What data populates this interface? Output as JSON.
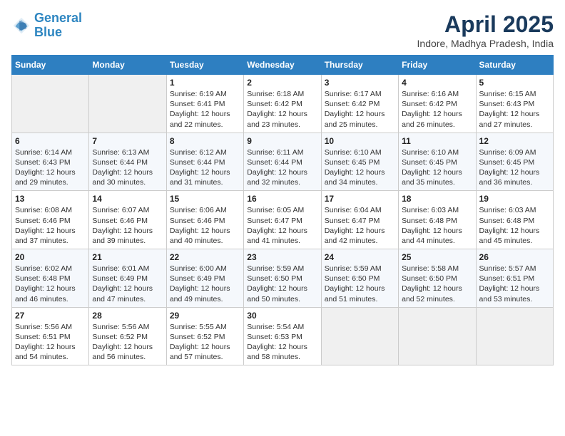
{
  "header": {
    "logo_line1": "General",
    "logo_line2": "Blue",
    "title": "April 2025",
    "subtitle": "Indore, Madhya Pradesh, India"
  },
  "days_of_week": [
    "Sunday",
    "Monday",
    "Tuesday",
    "Wednesday",
    "Thursday",
    "Friday",
    "Saturday"
  ],
  "weeks": [
    [
      {
        "day": "",
        "sunrise": "",
        "sunset": "",
        "daylight": ""
      },
      {
        "day": "",
        "sunrise": "",
        "sunset": "",
        "daylight": ""
      },
      {
        "day": "1",
        "sunrise": "Sunrise: 6:19 AM",
        "sunset": "Sunset: 6:41 PM",
        "daylight": "Daylight: 12 hours and 22 minutes."
      },
      {
        "day": "2",
        "sunrise": "Sunrise: 6:18 AM",
        "sunset": "Sunset: 6:42 PM",
        "daylight": "Daylight: 12 hours and 23 minutes."
      },
      {
        "day": "3",
        "sunrise": "Sunrise: 6:17 AM",
        "sunset": "Sunset: 6:42 PM",
        "daylight": "Daylight: 12 hours and 25 minutes."
      },
      {
        "day": "4",
        "sunrise": "Sunrise: 6:16 AM",
        "sunset": "Sunset: 6:42 PM",
        "daylight": "Daylight: 12 hours and 26 minutes."
      },
      {
        "day": "5",
        "sunrise": "Sunrise: 6:15 AM",
        "sunset": "Sunset: 6:43 PM",
        "daylight": "Daylight: 12 hours and 27 minutes."
      }
    ],
    [
      {
        "day": "6",
        "sunrise": "Sunrise: 6:14 AM",
        "sunset": "Sunset: 6:43 PM",
        "daylight": "Daylight: 12 hours and 29 minutes."
      },
      {
        "day": "7",
        "sunrise": "Sunrise: 6:13 AM",
        "sunset": "Sunset: 6:44 PM",
        "daylight": "Daylight: 12 hours and 30 minutes."
      },
      {
        "day": "8",
        "sunrise": "Sunrise: 6:12 AM",
        "sunset": "Sunset: 6:44 PM",
        "daylight": "Daylight: 12 hours and 31 minutes."
      },
      {
        "day": "9",
        "sunrise": "Sunrise: 6:11 AM",
        "sunset": "Sunset: 6:44 PM",
        "daylight": "Daylight: 12 hours and 32 minutes."
      },
      {
        "day": "10",
        "sunrise": "Sunrise: 6:10 AM",
        "sunset": "Sunset: 6:45 PM",
        "daylight": "Daylight: 12 hours and 34 minutes."
      },
      {
        "day": "11",
        "sunrise": "Sunrise: 6:10 AM",
        "sunset": "Sunset: 6:45 PM",
        "daylight": "Daylight: 12 hours and 35 minutes."
      },
      {
        "day": "12",
        "sunrise": "Sunrise: 6:09 AM",
        "sunset": "Sunset: 6:45 PM",
        "daylight": "Daylight: 12 hours and 36 minutes."
      }
    ],
    [
      {
        "day": "13",
        "sunrise": "Sunrise: 6:08 AM",
        "sunset": "Sunset: 6:46 PM",
        "daylight": "Daylight: 12 hours and 37 minutes."
      },
      {
        "day": "14",
        "sunrise": "Sunrise: 6:07 AM",
        "sunset": "Sunset: 6:46 PM",
        "daylight": "Daylight: 12 hours and 39 minutes."
      },
      {
        "day": "15",
        "sunrise": "Sunrise: 6:06 AM",
        "sunset": "Sunset: 6:46 PM",
        "daylight": "Daylight: 12 hours and 40 minutes."
      },
      {
        "day": "16",
        "sunrise": "Sunrise: 6:05 AM",
        "sunset": "Sunset: 6:47 PM",
        "daylight": "Daylight: 12 hours and 41 minutes."
      },
      {
        "day": "17",
        "sunrise": "Sunrise: 6:04 AM",
        "sunset": "Sunset: 6:47 PM",
        "daylight": "Daylight: 12 hours and 42 minutes."
      },
      {
        "day": "18",
        "sunrise": "Sunrise: 6:03 AM",
        "sunset": "Sunset: 6:48 PM",
        "daylight": "Daylight: 12 hours and 44 minutes."
      },
      {
        "day": "19",
        "sunrise": "Sunrise: 6:03 AM",
        "sunset": "Sunset: 6:48 PM",
        "daylight": "Daylight: 12 hours and 45 minutes."
      }
    ],
    [
      {
        "day": "20",
        "sunrise": "Sunrise: 6:02 AM",
        "sunset": "Sunset: 6:48 PM",
        "daylight": "Daylight: 12 hours and 46 minutes."
      },
      {
        "day": "21",
        "sunrise": "Sunrise: 6:01 AM",
        "sunset": "Sunset: 6:49 PM",
        "daylight": "Daylight: 12 hours and 47 minutes."
      },
      {
        "day": "22",
        "sunrise": "Sunrise: 6:00 AM",
        "sunset": "Sunset: 6:49 PM",
        "daylight": "Daylight: 12 hours and 49 minutes."
      },
      {
        "day": "23",
        "sunrise": "Sunrise: 5:59 AM",
        "sunset": "Sunset: 6:50 PM",
        "daylight": "Daylight: 12 hours and 50 minutes."
      },
      {
        "day": "24",
        "sunrise": "Sunrise: 5:59 AM",
        "sunset": "Sunset: 6:50 PM",
        "daylight": "Daylight: 12 hours and 51 minutes."
      },
      {
        "day": "25",
        "sunrise": "Sunrise: 5:58 AM",
        "sunset": "Sunset: 6:50 PM",
        "daylight": "Daylight: 12 hours and 52 minutes."
      },
      {
        "day": "26",
        "sunrise": "Sunrise: 5:57 AM",
        "sunset": "Sunset: 6:51 PM",
        "daylight": "Daylight: 12 hours and 53 minutes."
      }
    ],
    [
      {
        "day": "27",
        "sunrise": "Sunrise: 5:56 AM",
        "sunset": "Sunset: 6:51 PM",
        "daylight": "Daylight: 12 hours and 54 minutes."
      },
      {
        "day": "28",
        "sunrise": "Sunrise: 5:56 AM",
        "sunset": "Sunset: 6:52 PM",
        "daylight": "Daylight: 12 hours and 56 minutes."
      },
      {
        "day": "29",
        "sunrise": "Sunrise: 5:55 AM",
        "sunset": "Sunset: 6:52 PM",
        "daylight": "Daylight: 12 hours and 57 minutes."
      },
      {
        "day": "30",
        "sunrise": "Sunrise: 5:54 AM",
        "sunset": "Sunset: 6:53 PM",
        "daylight": "Daylight: 12 hours and 58 minutes."
      },
      {
        "day": "",
        "sunrise": "",
        "sunset": "",
        "daylight": ""
      },
      {
        "day": "",
        "sunrise": "",
        "sunset": "",
        "daylight": ""
      },
      {
        "day": "",
        "sunrise": "",
        "sunset": "",
        "daylight": ""
      }
    ]
  ]
}
